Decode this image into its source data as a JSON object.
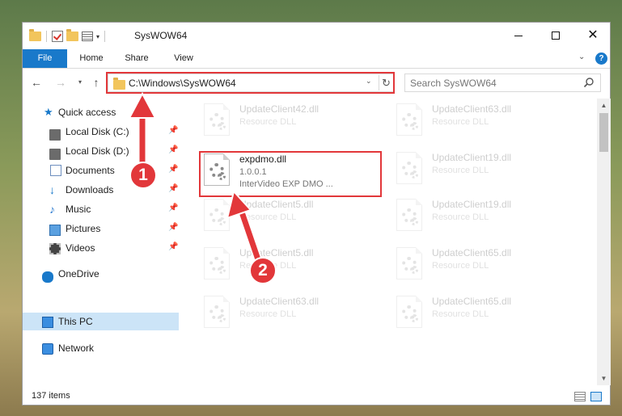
{
  "window": {
    "title": "SysWOW64",
    "controls": {
      "minimize": "—",
      "maximize": "☐",
      "close": "✕"
    }
  },
  "ribbon": {
    "tabs": [
      "File",
      "Home",
      "Share",
      "View"
    ],
    "help": "?"
  },
  "navigation": {
    "address": "C:\\Windows\\SysWOW64",
    "search_placeholder": "Search SysWOW64"
  },
  "sidebar": {
    "items": [
      {
        "label": "Quick access",
        "icon": "star-icon"
      },
      {
        "label": "Local Disk (C:)",
        "icon": "disk-icon",
        "pinned": true
      },
      {
        "label": "Local Disk (D:)",
        "icon": "disk-icon",
        "pinned": true
      },
      {
        "label": "Documents",
        "icon": "documents-icon",
        "pinned": true
      },
      {
        "label": "Downloads",
        "icon": "downloads-icon",
        "pinned": true
      },
      {
        "label": "Music",
        "icon": "music-icon",
        "pinned": true
      },
      {
        "label": "Pictures",
        "icon": "pictures-icon",
        "pinned": true
      },
      {
        "label": "Videos",
        "icon": "videos-icon",
        "pinned": true
      },
      {
        "label": "OneDrive",
        "icon": "onedrive-icon"
      },
      {
        "label": "This PC",
        "icon": "this-pc-icon",
        "selected": true
      },
      {
        "label": "Network",
        "icon": "network-icon"
      }
    ]
  },
  "files": {
    "focused": {
      "name": "expdmo.dll",
      "version": "1.0.0.1",
      "description": "InterVideo EXP DMO ..."
    },
    "left_column": [
      {
        "name": "UpdateClient42.dll",
        "type": "Resource DLL"
      },
      {
        "name": "UpdateClient5.dll",
        "type": "Resource DLL"
      },
      {
        "name": "UpdateClient5.dll",
        "type": "Resource DLL"
      },
      {
        "name": "UpdateClient63.dll",
        "type": "Resource DLL"
      }
    ],
    "right_column": [
      {
        "name": "UpdateClient63.dll",
        "type": "Resource DLL"
      },
      {
        "name": "UpdateClient19.dll",
        "type": "Resource DLL"
      },
      {
        "name": "UpdateClient19.dll",
        "type": "Resource DLL"
      },
      {
        "name": "UpdateClient65.dll",
        "type": "Resource DLL"
      },
      {
        "name": "UpdateClient65.dll",
        "type": "Resource DLL"
      }
    ]
  },
  "status": {
    "item_count": "137 items"
  },
  "annotations": {
    "step1": "1",
    "step2": "2",
    "color": "#e2373a"
  }
}
